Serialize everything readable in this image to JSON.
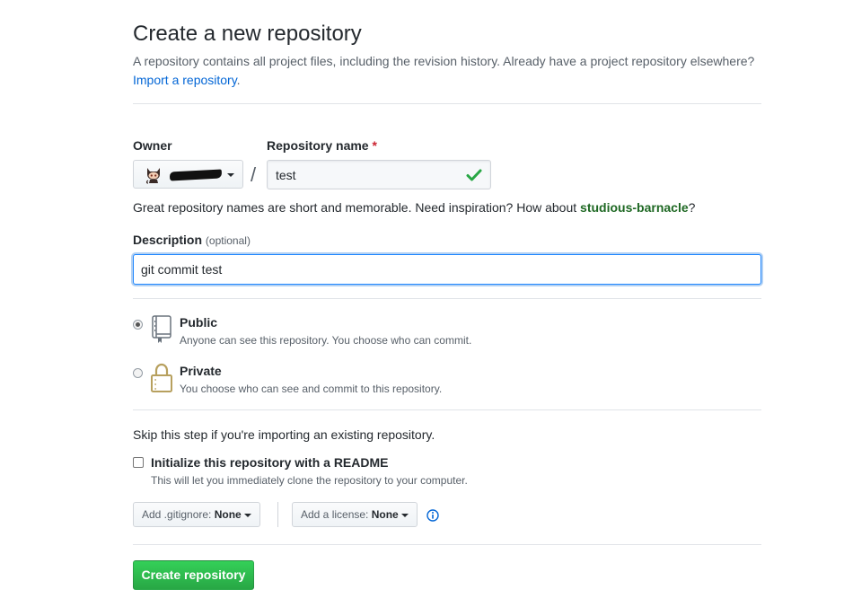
{
  "header": {
    "title": "Create a new repository",
    "subtitle": "A repository contains all project files, including the revision history. Already have a project repository elsewhere?",
    "import_link": "Import a repository",
    "import_suffix": "."
  },
  "owner": {
    "label": "Owner",
    "avatar_icon": "octocat-avatar-icon"
  },
  "repo": {
    "label": "Repository name",
    "required_mark": "*",
    "separator": "/",
    "value": "test",
    "status_icon": "check-icon"
  },
  "hint": {
    "prefix": "Great repository names are short and memorable. Need inspiration? How about",
    "suggestion": "studious-barnacle",
    "suffix": "?"
  },
  "description": {
    "label": "Description",
    "optional": "(optional)",
    "value": "git commit test"
  },
  "visibility": {
    "public": {
      "title": "Public",
      "note": "Anyone can see this repository. You choose who can commit.",
      "icon": "repo-book-icon",
      "selected": true
    },
    "private": {
      "title": "Private",
      "note": "You choose who can see and commit to this repository.",
      "icon": "lock-icon",
      "selected": false
    }
  },
  "init": {
    "skip_note": "Skip this step if you're importing an existing repository.",
    "readme_label": "Initialize this repository with a README",
    "readme_note": "This will let you immediately clone the repository to your computer.",
    "gitignore_prefix": "Add .gitignore:",
    "gitignore_value": "None",
    "license_prefix": "Add a license:",
    "license_value": "None",
    "info_icon": "info-icon"
  },
  "actions": {
    "create_label": "Create repository"
  },
  "colors": {
    "link": "#0366d6",
    "primary_button": "#28a745",
    "required": "#cb2431",
    "suggestion": "#1e6823",
    "focus_border": "#2188ff"
  }
}
